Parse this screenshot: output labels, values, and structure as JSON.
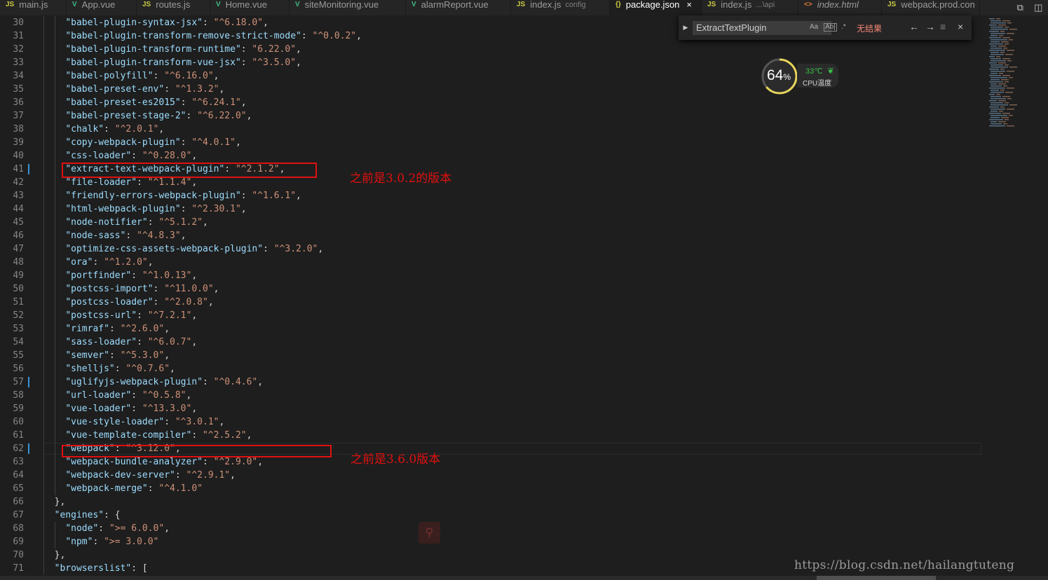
{
  "tabs": [
    {
      "icon": "JS",
      "icon_color": "#cbcb41",
      "name": "main.js",
      "desc": "",
      "active": false,
      "italic": false,
      "width": 95
    },
    {
      "icon": "V",
      "icon_color": "#41b883",
      "name": "App.vue",
      "desc": "",
      "active": false,
      "italic": false,
      "width": 100
    },
    {
      "icon": "JS",
      "icon_color": "#cbcb41",
      "name": "routes.js",
      "desc": "",
      "active": false,
      "italic": false,
      "width": 105
    },
    {
      "icon": "V",
      "icon_color": "#41b883",
      "name": "Home.vue",
      "desc": "",
      "active": false,
      "italic": false,
      "width": 113
    },
    {
      "icon": "V",
      "icon_color": "#41b883",
      "name": "siteMonitoring.vue",
      "desc": "",
      "active": false,
      "italic": false,
      "width": 166
    },
    {
      "icon": "V",
      "icon_color": "#41b883",
      "name": "alarmReport.vue",
      "desc": "",
      "active": false,
      "italic": false,
      "width": 150
    },
    {
      "icon": "JS",
      "icon_color": "#cbcb41",
      "name": "index.js",
      "desc": "config",
      "active": false,
      "italic": false,
      "width": 141
    },
    {
      "icon": "{}",
      "icon_color": "#cbcb41",
      "name": "package.json",
      "desc": "",
      "active": true,
      "italic": false,
      "width": 131,
      "close": "×"
    },
    {
      "icon": "JS",
      "icon_color": "#cbcb41",
      "name": "index.js",
      "desc": "...\\api",
      "active": false,
      "italic": false,
      "width": 138
    },
    {
      "icon": "<>",
      "icon_color": "#e37933",
      "name": "index.html",
      "desc": "",
      "active": false,
      "italic": true,
      "width": 119
    },
    {
      "icon": "JS",
      "icon_color": "#cbcb41",
      "name": "webpack.prod.con",
      "desc": "",
      "active": false,
      "italic": false,
      "width": 140
    }
  ],
  "find": {
    "query": "ExtractTextPlugin",
    "opt_case": "Aa",
    "opt_word": "Ab|",
    "opt_regex": ".*",
    "status": "无结果",
    "prev": "←",
    "next": "→",
    "selection": "≡",
    "close": "×"
  },
  "cpu": {
    "percent": "64",
    "percent_unit": "%",
    "temp": "33℃",
    "label": "CPU温度",
    "usage": 0.64
  },
  "editor": {
    "lines": [
      {
        "n": "30",
        "i": 2,
        "k": "\"babel-plugin-syntax-jsx\"",
        "v": "\"^6.18.0\"",
        "e": ","
      },
      {
        "n": "31",
        "i": 2,
        "k": "\"babel-plugin-transform-remove-strict-mode\"",
        "v": "\"^0.0.2\"",
        "e": ","
      },
      {
        "n": "32",
        "i": 2,
        "k": "\"babel-plugin-transform-runtime\"",
        "v": "\"6.22.0\"",
        "e": ","
      },
      {
        "n": "33",
        "i": 2,
        "k": "\"babel-plugin-transform-vue-jsx\"",
        "v": "\"^3.5.0\"",
        "e": ","
      },
      {
        "n": "34",
        "i": 2,
        "k": "\"babel-polyfill\"",
        "v": "\"^6.16.0\"",
        "e": ","
      },
      {
        "n": "35",
        "i": 2,
        "k": "\"babel-preset-env\"",
        "v": "\"^1.3.2\"",
        "e": ","
      },
      {
        "n": "36",
        "i": 2,
        "k": "\"babel-preset-es2015\"",
        "v": "\"^6.24.1\"",
        "e": ","
      },
      {
        "n": "37",
        "i": 2,
        "k": "\"babel-preset-stage-2\"",
        "v": "\"^6.22.0\"",
        "e": ","
      },
      {
        "n": "38",
        "i": 2,
        "k": "\"chalk\"",
        "v": "\"^2.0.1\"",
        "e": ","
      },
      {
        "n": "39",
        "i": 2,
        "k": "\"copy-webpack-plugin\"",
        "v": "\"^4.0.1\"",
        "e": ","
      },
      {
        "n": "40",
        "i": 2,
        "k": "\"css-loader\"",
        "v": "\"^0.28.0\"",
        "e": ","
      },
      {
        "n": "41",
        "i": 2,
        "k": "\"extract-text-webpack-plugin\"",
        "v": "\"^2.1.2\"",
        "e": ",",
        "m": true
      },
      {
        "n": "42",
        "i": 2,
        "k": "\"file-loader\"",
        "v": "\"^1.1.4\"",
        "e": ","
      },
      {
        "n": "43",
        "i": 2,
        "k": "\"friendly-errors-webpack-plugin\"",
        "v": "\"^1.6.1\"",
        "e": ","
      },
      {
        "n": "44",
        "i": 2,
        "k": "\"html-webpack-plugin\"",
        "v": "\"^2.30.1\"",
        "e": ","
      },
      {
        "n": "45",
        "i": 2,
        "k": "\"node-notifier\"",
        "v": "\"^5.1.2\"",
        "e": ","
      },
      {
        "n": "46",
        "i": 2,
        "k": "\"node-sass\"",
        "v": "\"^4.8.3\"",
        "e": ","
      },
      {
        "n": "47",
        "i": 2,
        "k": "\"optimize-css-assets-webpack-plugin\"",
        "v": "\"^3.2.0\"",
        "e": ","
      },
      {
        "n": "48",
        "i": 2,
        "k": "\"ora\"",
        "v": "\"^1.2.0\"",
        "e": ","
      },
      {
        "n": "49",
        "i": 2,
        "k": "\"portfinder\"",
        "v": "\"^1.0.13\"",
        "e": ","
      },
      {
        "n": "50",
        "i": 2,
        "k": "\"postcss-import\"",
        "v": "\"^11.0.0\"",
        "e": ","
      },
      {
        "n": "51",
        "i": 2,
        "k": "\"postcss-loader\"",
        "v": "\"^2.0.8\"",
        "e": ","
      },
      {
        "n": "52",
        "i": 2,
        "k": "\"postcss-url\"",
        "v": "\"^7.2.1\"",
        "e": ","
      },
      {
        "n": "53",
        "i": 2,
        "k": "\"rimraf\"",
        "v": "\"^2.6.0\"",
        "e": ","
      },
      {
        "n": "54",
        "i": 2,
        "k": "\"sass-loader\"",
        "v": "\"^6.0.7\"",
        "e": ","
      },
      {
        "n": "55",
        "i": 2,
        "k": "\"semver\"",
        "v": "\"^5.3.0\"",
        "e": ","
      },
      {
        "n": "56",
        "i": 2,
        "k": "\"shelljs\"",
        "v": "\"^0.7.6\"",
        "e": ","
      },
      {
        "n": "57",
        "i": 2,
        "k": "\"uglifyjs-webpack-plugin\"",
        "v": "\"^0.4.6\"",
        "e": ",",
        "m": true
      },
      {
        "n": "58",
        "i": 2,
        "k": "\"url-loader\"",
        "v": "\"^0.5.8\"",
        "e": ","
      },
      {
        "n": "59",
        "i": 2,
        "k": "\"vue-loader\"",
        "v": "\"^13.3.0\"",
        "e": ","
      },
      {
        "n": "60",
        "i": 2,
        "k": "\"vue-style-loader\"",
        "v": "\"^3.0.1\"",
        "e": ","
      },
      {
        "n": "61",
        "i": 2,
        "k": "\"vue-template-compiler\"",
        "v": "\"^2.5.2\"",
        "e": ","
      },
      {
        "n": "62",
        "i": 2,
        "k": "\"webpack\"",
        "v": "\"^3.12.0\"",
        "e": ",",
        "m": true,
        "cur": true
      },
      {
        "n": "63",
        "i": 2,
        "k": "\"webpack-bundle-analyzer\"",
        "v": "\"^2.9.0\"",
        "e": ","
      },
      {
        "n": "64",
        "i": 2,
        "k": "\"webpack-dev-server\"",
        "v": "\"^2.9.1\"",
        "e": ","
      },
      {
        "n": "65",
        "i": 2,
        "k": "\"webpack-merge\"",
        "v": "\"^4.1.0\"",
        "e": ""
      },
      {
        "n": "66",
        "i": 1,
        "k": "",
        "v": "",
        "e": "},"
      },
      {
        "n": "67",
        "i": 1,
        "k": "\"engines\"",
        "v": "",
        "e": " {"
      },
      {
        "n": "68",
        "i": 2,
        "k": "\"node\"",
        "v": "\">= 6.0.0\"",
        "e": ","
      },
      {
        "n": "69",
        "i": 2,
        "k": "\"npm\"",
        "v": "\">= 3.0.0\"",
        "e": ""
      },
      {
        "n": "70",
        "i": 1,
        "k": "",
        "v": "",
        "e": "},"
      },
      {
        "n": "71",
        "i": 1,
        "k": "\"browserslist\"",
        "v": "",
        "e": " ["
      }
    ]
  },
  "annotations": {
    "note1": "之前是3.0.2的版本",
    "note2": "之前是3.6.0版本",
    "color": "#e01010"
  },
  "watermark": "https://blog.csdn.net/hailangtuteng",
  "tab_actions": {
    "split_icon": "split-editor-icon",
    "layout_icon": "toggle-layout-icon"
  }
}
